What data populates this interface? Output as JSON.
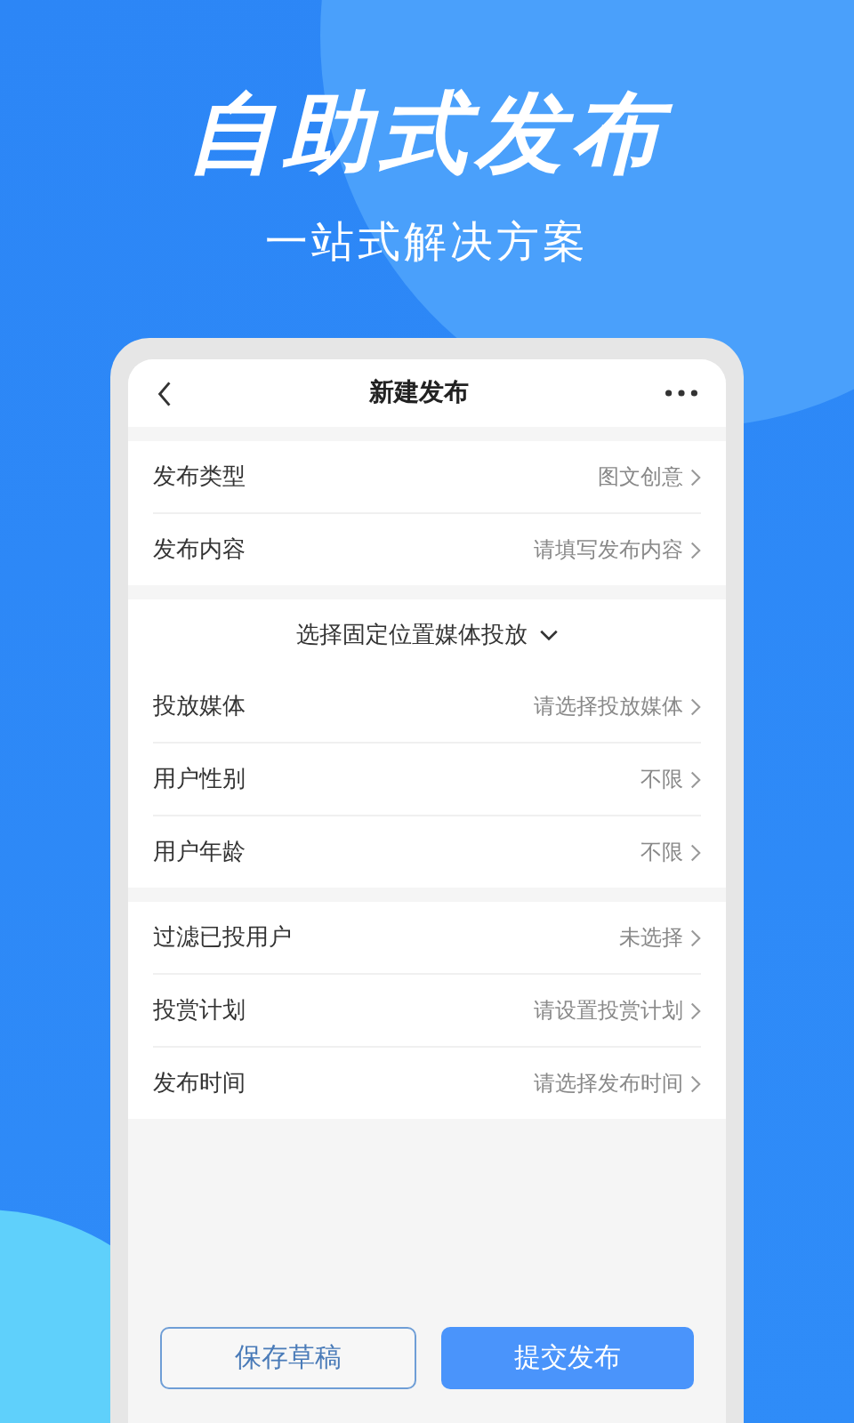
{
  "hero": {
    "title": "自助式发布",
    "subtitle": "一站式解决方案"
  },
  "screen": {
    "header": {
      "title": "新建发布"
    },
    "groups": [
      {
        "rows": [
          {
            "label": "发布类型",
            "value": "图文创意"
          },
          {
            "label": "发布内容",
            "value": "请填写发布内容"
          }
        ]
      },
      {
        "dropdown": "选择固定位置媒体投放",
        "rows": [
          {
            "label": "投放媒体",
            "value": "请选择投放媒体"
          },
          {
            "label": "用户性别",
            "value": "不限"
          },
          {
            "label": "用户年龄",
            "value": "不限"
          }
        ]
      },
      {
        "rows": [
          {
            "label": "过滤已投用户",
            "value": "未选择"
          },
          {
            "label": "投赏计划",
            "value": "请设置投赏计划"
          },
          {
            "label": "发布时间",
            "value": "请选择发布时间"
          }
        ]
      }
    ],
    "buttons": [
      {
        "label": "保存草稿",
        "kind": "outline"
      },
      {
        "label": "提交发布",
        "kind": "primary"
      }
    ]
  }
}
